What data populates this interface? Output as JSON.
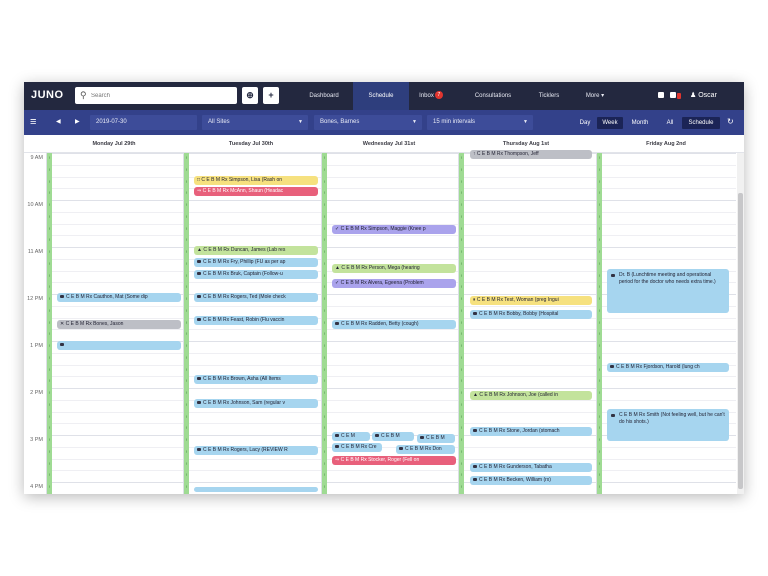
{
  "nav": {
    "logo": "JUNO",
    "search_placeholder": "Search",
    "tabs": [
      "Dashboard",
      "Schedule",
      "Inbox",
      "Consultations",
      "Ticklers",
      "More ▾"
    ],
    "inbox_count": "7",
    "user": "Oscar"
  },
  "toolbar": {
    "date": "2019-07-30",
    "sites": "All Sites",
    "provider": "Bones, Barnes",
    "interval": "15 min intervals",
    "views": [
      "Day",
      "Week",
      "Month",
      "All"
    ],
    "schedule_btn": "Schedule"
  },
  "calendar": {
    "days": [
      "Monday Jul 29th",
      "Tuesday Jul 30th",
      "Wednesday Jul 31st",
      "Thursday Aug 1st",
      "Friday Aug 2nd"
    ],
    "times": [
      "9 AM",
      "10 AM",
      "11 AM",
      "12 PM",
      "1 PM",
      "2 PM",
      "3 PM",
      "4 PM"
    ],
    "tick": "!",
    "appointments": {
      "mon": [
        "C E B M Rx Cauthon, Mat (Some dip",
        "C E B M Rx Bones, Jason",
        ""
      ],
      "tue": [
        "C E B M Rx Simpson, Lisa (Rash on",
        "C E B M Rx McAnn, Shaun (Headac",
        "C E B M Rx Duncan, James (Lab res",
        "C E B M Rx Fry, Phillip (FU as per ap",
        "C E B M Rx Bruk, Captain (Follow-u",
        "C E B M Rx Rogers, Ted (Mole check",
        "C E B M Rx Feast, Robin (Flu vaccin",
        "C E B M Rx Brown, Asha (All Items",
        "C E B M Rx Johnson, Sam (regular v",
        "C E B M Rx Rogers, Lacy (REVIEW R"
      ],
      "wed": [
        "C E B M Rx Simpson, Maggie (Knee p",
        "C E B M Rx Person, Mega (hearing",
        "C E B M Rx Alvera, Egeena (Problem",
        "C E B M Rx Radden, Betty (cough)",
        "C E M",
        "C E B M",
        "C E B M",
        "C E B M Rx Cre",
        "C E B M Rx Don",
        "C E B M Rx Stocker, Roger (Fell on"
      ],
      "thu": [
        "C E B M Rx Thompson, Jeff",
        "C E B M Rx Test, Woman (preg Ingui",
        "C E B M Rx Bobby, Bobby (Hospital",
        "C E B M Rx Johnson, Joe (called in",
        "C E B M Rx Stone, Jordan (stomach",
        "C E B M Rx Gunderson, Tabatha",
        "C E B M Rx Becken, William (rx)"
      ],
      "fri": [
        "C E B M Rx Fjordson, Harold (lung ch"
      ]
    },
    "notes": {
      "fri_lunch": "Dr. B (Lunchtime meeting and operational period for the doctor who needs extra time.)",
      "fri_smith": "C E B M Rx Smith (Not feeling well, but he can't do his shots.)"
    }
  }
}
